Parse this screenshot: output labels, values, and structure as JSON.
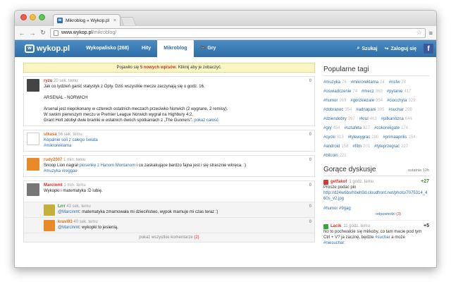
{
  "browser": {
    "tab_title": "Mikroblog « Wykop.pl",
    "tab_close": "×",
    "url_host": "www.wykop.pl",
    "url_path": "/mikroblog/",
    "back": "←",
    "forward": "→",
    "reload": "↻",
    "star": "☆",
    "menu": "≡"
  },
  "nav": {
    "logo": "wykop.pl",
    "logo_mark": "w",
    "items": [
      "Wykopalisko (268)",
      "Hity",
      "Mikroblog",
      "Gry"
    ],
    "search": "Szukaj",
    "login": "Zaloguj się",
    "fb": "f",
    "search_icon": "⌕",
    "login_icon": "↪",
    "gry_icon": "🎮"
  },
  "notice": {
    "pre": "Pojawiło się ",
    "count": "5 nowych wpisów",
    "post": ". Kliknij aby je zobaczyć."
  },
  "entries": [
    {
      "user": "ryzu",
      "time": "20 sek. temu",
      "votes": "0",
      "lines": [
        "Jak co tydzień garść statystyk z Opty. Dziś wszystkie mecze zaczynają się o godz. 16.",
        "",
        "ARSENAL - NORWICH",
        "",
        "Arsenal jest niepokonany w czterech ostatnich meczach przeciwko Norwich (2 wygrane, 2 remisy).",
        "W swoim pierwszym meczu w Premier League Norwich wygrał na Highbury 4:2."
      ],
      "last_line": "Grant Holt zdobył dwie bramki w ostatnich dwóch spotkaniach z „The Gunners\".",
      "show_more": "pokaż całość"
    },
    {
      "user": "ulkasa",
      "time": "56 sek. temu",
      "votes": "0",
      "line1": "Kopalnie soli z całego świata",
      "line2": "#mikroreklama"
    },
    {
      "user": "rudy2007",
      "time": "1 min. temu",
      "votes": "0",
      "pre": "Snoop Lion nagrał ",
      "link": "piosenkę z Hanom Montanom",
      "post": " i co zaskakujące bardzo fajna jest i się strasznie wkręca. :)",
      "tags": "#muzyka #reggae"
    },
    {
      "user": "Marcinmt",
      "time": "1 min. temu",
      "votes": "0",
      "line1": "Wykopki i matematyka :D lubię.",
      "comments": [
        {
          "user": "Lrrr",
          "time": "43 sek. temu",
          "votes": "0",
          "mention": "@Marcinmt",
          "text": ": matematyka zmarnowała mi dzieciństwo, wypok marnuje mi czas teraz :)"
        },
        {
          "user": "kravi93",
          "time": "40 sek. temu",
          "votes": "0",
          "mention": "@Marcinmt",
          "text": ": wykopki to jesienią."
        }
      ],
      "show_all": "pokaż wszystkie komentarze",
      "show_all_count": "(2)"
    }
  ],
  "sidebar": {
    "tags_title": "Popularne tagi",
    "tags": [
      [
        "#muzyka",
        "76"
      ],
      [
        "#mikroreklama",
        "74"
      ],
      [
        "#nsfw",
        "74"
      ],
      [
        "#oswiadczenie",
        "74"
      ],
      [
        "#mecz",
        "369"
      ],
      [
        "#pytanie",
        "417"
      ],
      [
        "#humor",
        "969"
      ],
      [
        "#gorzkiezale",
        "354"
      ],
      [
        "#ciocchyta",
        "329"
      ],
      [
        "#dobranoc",
        "354"
      ],
      [
        "#adnapani",
        "305"
      ],
      [
        "#suchar",
        "298"
      ],
      [
        "#dziendobry",
        "397"
      ],
      [
        "#krul",
        "463"
      ],
      [
        "#pilkanozna",
        "644"
      ],
      [
        "#gry",
        "454"
      ],
      [
        "#sztafeta",
        "827"
      ],
      [
        "#cokorekgate",
        "176"
      ],
      [
        "#cycki",
        "313"
      ],
      [
        "#tylewygrac",
        "280"
      ],
      [
        "#primaaprilis",
        "154"
      ],
      [
        "#android",
        "158"
      ],
      [
        "#film",
        "201"
      ],
      [
        "#tyleprzegrac",
        "227"
      ],
      [
        "#bitcoin",
        "221"
      ]
    ],
    "disc_title": "Gorące dyskusje",
    "disc_period": "ostatnie 12h",
    "discussions": [
      {
        "user": "getfakof",
        "time": "1 godz. temu",
        "score": "+27",
        "text": "Prosze podac pin",
        "link": "http://d24w6bsrhbeh9d.cloudfront.net/photo/7075314_460s_v2.jpg",
        "tags": "#humor #9gag",
        "answers": "odpowiedzi",
        "answers_count": "(3)"
      },
      {
        "user": "Lacik",
        "time": "11 godz. temu",
        "score": "+5",
        "text_pre": "No to pochwalcie się mirkoby, co tam macie pod tym Ctrl + V? ja zacznę, będzie ",
        "text_tag": "#suchar",
        "text_post": " a może",
        "tags": "#niesuchar:"
      }
    ]
  }
}
